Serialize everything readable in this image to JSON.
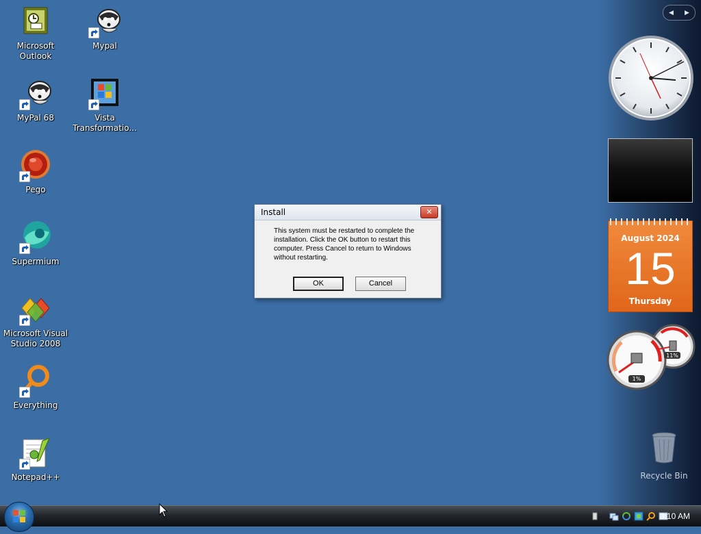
{
  "desktop": {
    "icons": [
      {
        "label": "Microsoft Outlook",
        "name": "outlook-icon"
      },
      {
        "label": "Mypal",
        "name": "mypal-icon"
      },
      {
        "label": "MyPal 68",
        "name": "mypal68-icon"
      },
      {
        "label": "Vista Transformatio...",
        "name": "vista-transformation-icon"
      },
      {
        "label": "Pego",
        "name": "pego-icon"
      },
      {
        "label": "Supermium",
        "name": "supermium-icon"
      },
      {
        "label": "Microsoft Visual Studio 2008",
        "name": "visual-studio-icon"
      },
      {
        "label": "Everything",
        "name": "everything-icon"
      },
      {
        "label": "Notepad++",
        "name": "notepadpp-icon"
      }
    ],
    "recycle_bin": "Recycle Bin"
  },
  "dialog": {
    "title": "Install",
    "message": "This system must be restarted to complete the installation. Click the OK button to restart this computer. Press Cancel to return to Windows without restarting.",
    "ok": "OK",
    "cancel": "Cancel"
  },
  "calendar": {
    "month_year": "August 2024",
    "day": "15",
    "weekday": "Thursday"
  },
  "meters": {
    "cpu": "1%",
    "memory": "11%"
  },
  "taskbar": {
    "time": "3:10 AM"
  },
  "colors": {
    "desktop": "#3c6ea6",
    "calendar": "#e8721f",
    "taskbar": "#1c1f24"
  }
}
